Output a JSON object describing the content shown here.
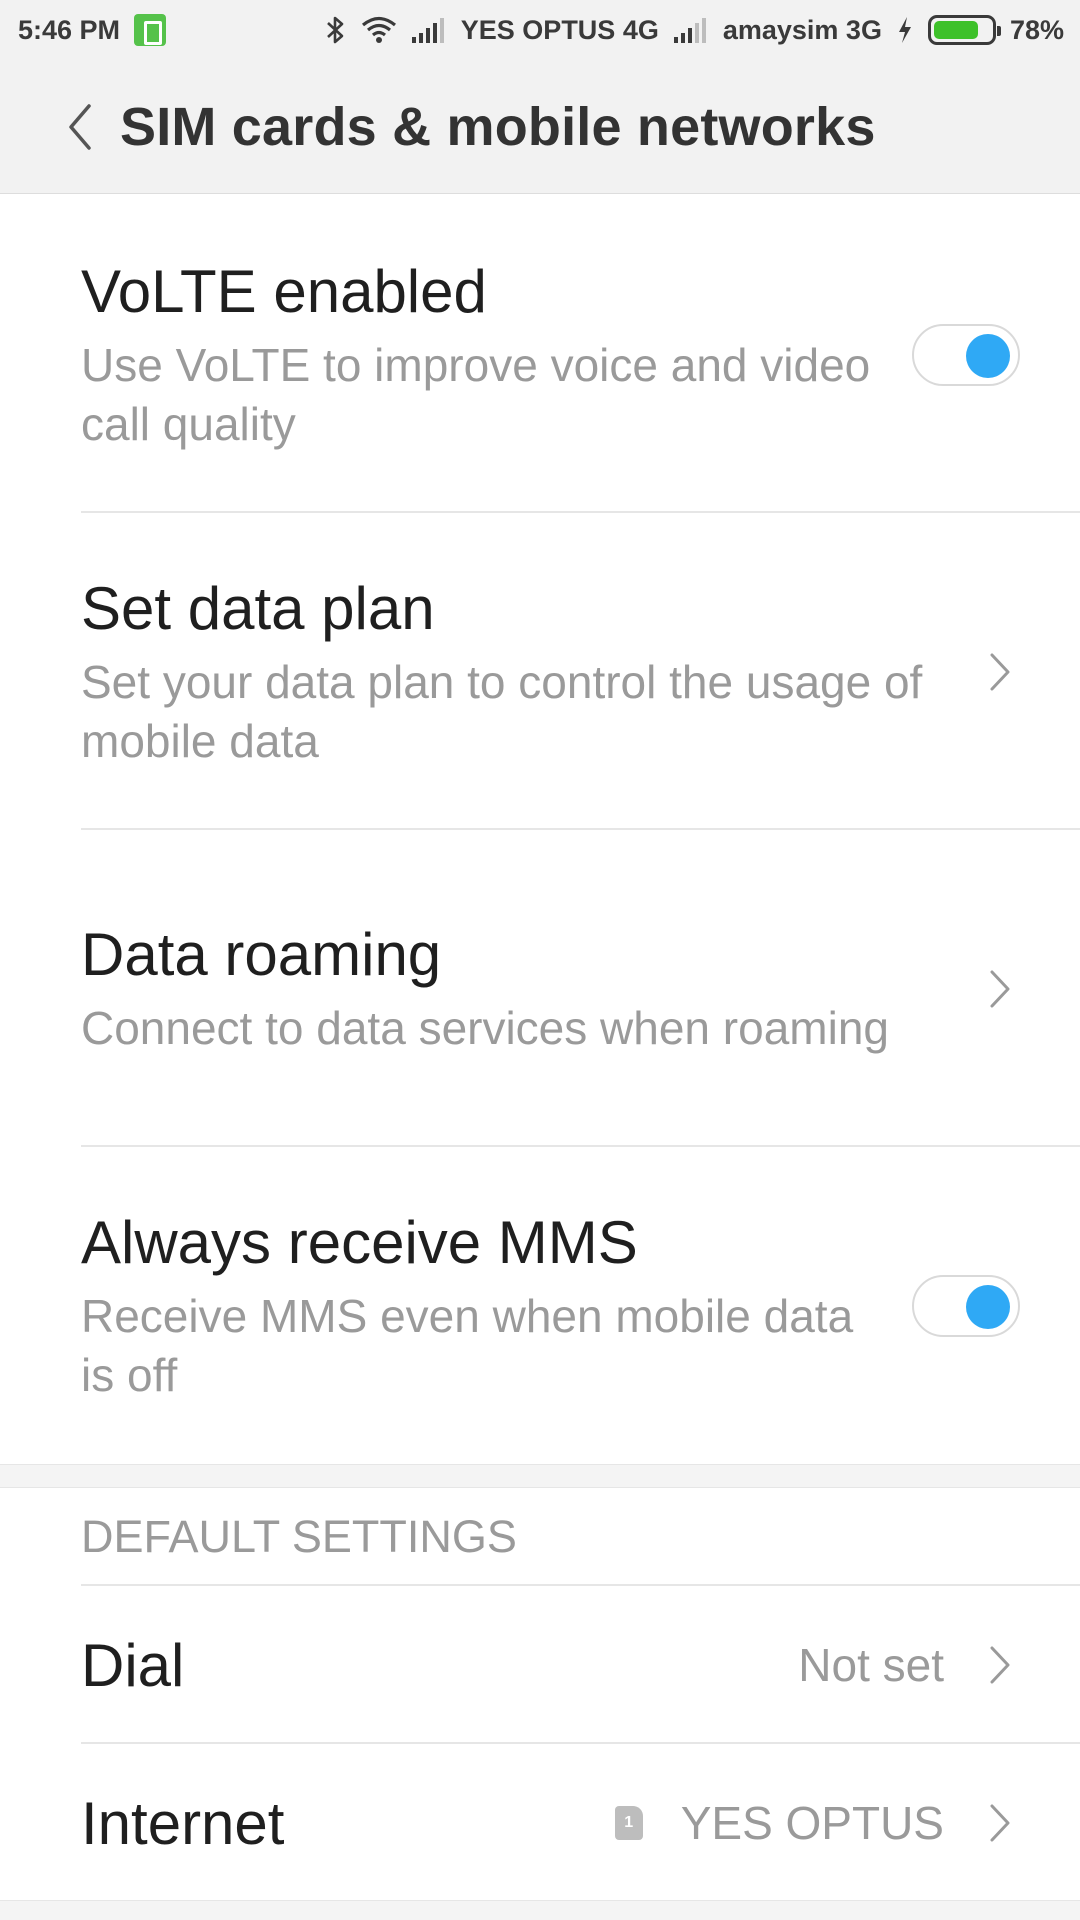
{
  "status_bar": {
    "time": "5:46 PM",
    "carrier1": "YES OPTUS 4G",
    "carrier2": "amaysim 3G",
    "battery_percent": "78%",
    "battery_level": 0.78,
    "icons": [
      "battery-saver-icon",
      "bluetooth-icon",
      "wifi-icon",
      "signal-icon",
      "signal-icon",
      "charging-icon",
      "battery-icon"
    ]
  },
  "header": {
    "title": "SIM cards & mobile networks",
    "back_icon": "chevron-left-icon"
  },
  "settings": {
    "volte": {
      "title": "VoLTE enabled",
      "subtitle": "Use VoLTE to improve voice and video call quality",
      "enabled": true
    },
    "data_plan": {
      "title": "Set data plan",
      "subtitle": "Set your data plan to control the usage of mobile data"
    },
    "roaming": {
      "title": "Data roaming",
      "subtitle": "Connect to data services when roaming"
    },
    "mms": {
      "title": "Always receive MMS",
      "subtitle": "Receive MMS even when mobile data is off",
      "enabled": true
    }
  },
  "default_settings": {
    "header": "DEFAULT SETTINGS",
    "dial": {
      "title": "Dial",
      "value": "Not set"
    },
    "internet": {
      "title": "Internet",
      "sim_number": "1",
      "value": "YES OPTUS"
    }
  },
  "colors": {
    "accent": "#2fa9f5",
    "battery_fill": "#3ec12a",
    "battery_saver": "#55c24a"
  }
}
